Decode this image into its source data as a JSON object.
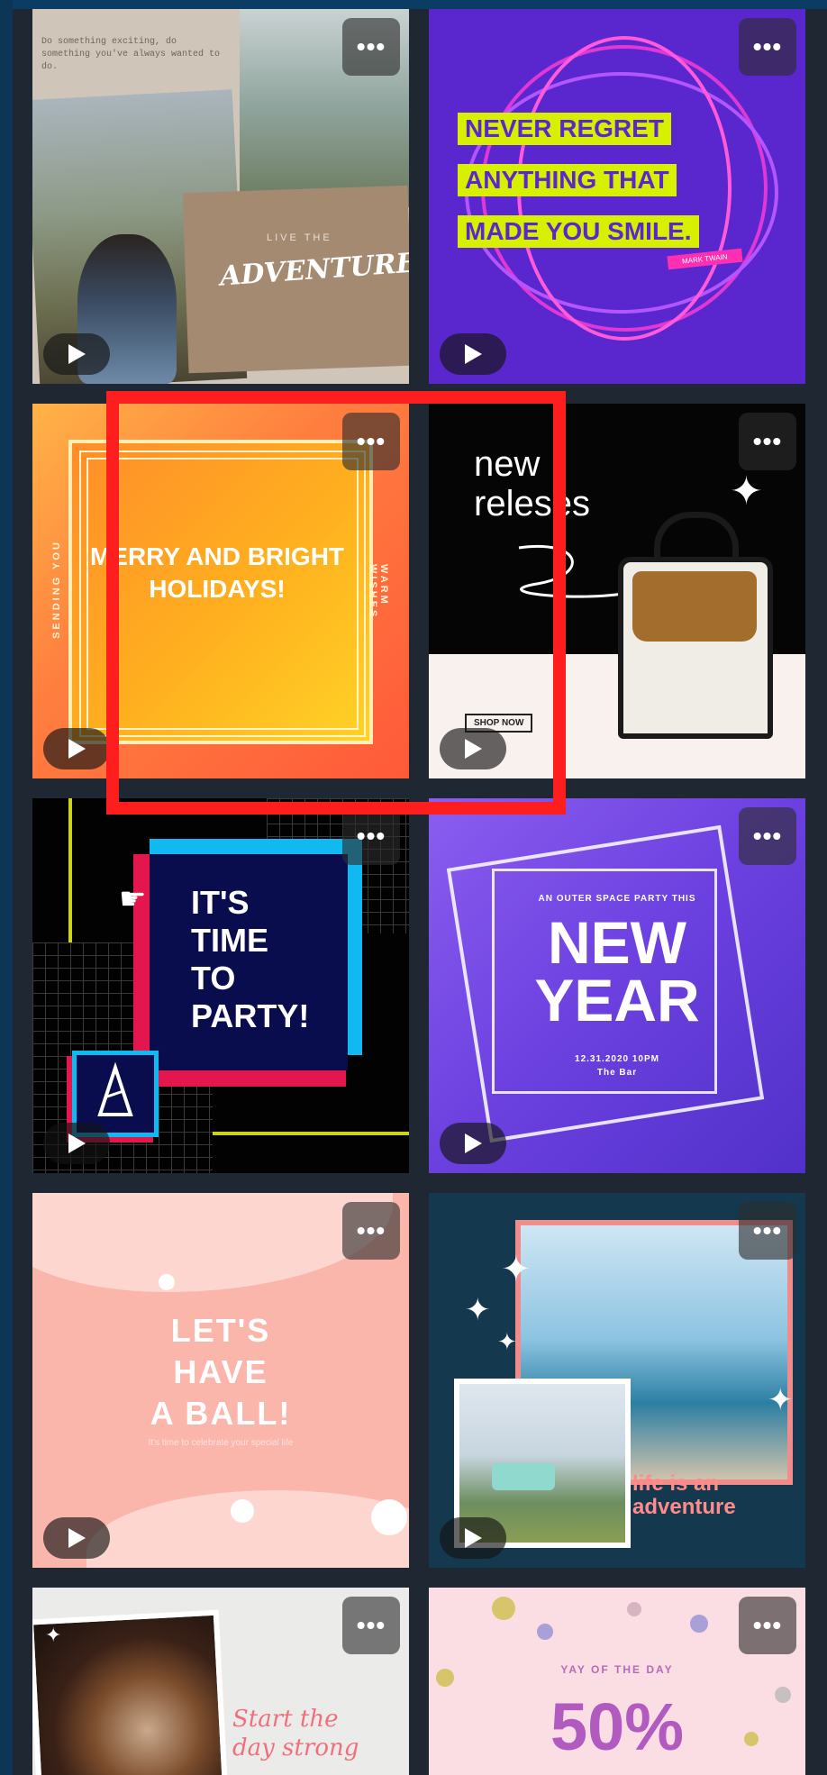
{
  "controls": {
    "more_label": "•••"
  },
  "tiles": {
    "adventure": {
      "note": "Do something exciting, do something you've always wanted to do.",
      "live": "LIVE THE",
      "title": "ADVENTURE"
    },
    "never_regret": {
      "lines": [
        "NEVER REGRET",
        "ANYTHING THAT",
        "MADE YOU SMILE."
      ],
      "signature": "MARK TWAIN"
    },
    "holidays": {
      "message": "MERRY AND BRIGHT HOLIDAYS!",
      "left_vertical": "SENDING YOU",
      "right_vertical": "WARM WISHES"
    },
    "new_releases": {
      "title_line1": "new",
      "title_line2": "releses",
      "cta": "SHOP NOW"
    },
    "party": {
      "lines": [
        "IT'S",
        "TIME",
        "TO",
        "PARTY!"
      ]
    },
    "new_year": {
      "subtitle": "AN OUTER SPACE PARTY THIS",
      "title_line1": "NEW",
      "title_line2": "YEAR",
      "date": "12.31.2020 10PM",
      "venue": "The Bar"
    },
    "ball": {
      "lines": [
        "LET'S",
        "HAVE",
        "A BALL!"
      ],
      "small": "It's time to celebrate your special life"
    },
    "life_adventure": {
      "line1": "life is an",
      "line2": "adventure"
    },
    "coffee": {
      "line1": "Start the",
      "line2": "day strong"
    },
    "sale": {
      "tag": "YAY OF THE DAY",
      "amount": "50%"
    }
  },
  "colors": {
    "highlight": "#ff1e1e",
    "accent_purple": "#5a27cf",
    "accent_lime": "#d6f000"
  }
}
